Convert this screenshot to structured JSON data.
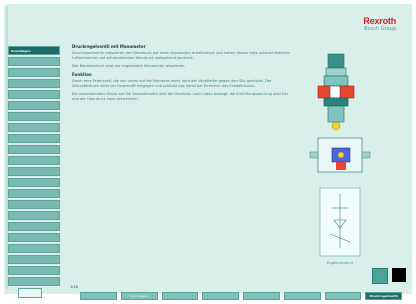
{
  "brand": {
    "name": "Rexroth",
    "sub": "Bosch Group"
  },
  "sidebar": {
    "items": [
      {
        "label": "Grundlagen",
        "active": true
      },
      {
        "label": ""
      },
      {
        "label": ""
      },
      {
        "label": ""
      },
      {
        "label": ""
      },
      {
        "label": ""
      },
      {
        "label": ""
      },
      {
        "label": ""
      },
      {
        "label": ""
      },
      {
        "label": ""
      },
      {
        "label": ""
      },
      {
        "label": ""
      },
      {
        "label": ""
      },
      {
        "label": ""
      },
      {
        "label": ""
      },
      {
        "label": ""
      },
      {
        "label": ""
      },
      {
        "label": ""
      },
      {
        "label": ""
      },
      {
        "label": ""
      },
      {
        "label": ""
      },
      {
        "label": ""
      }
    ]
  },
  "content": {
    "heading": "Druckregelventil mit Manometer",
    "p1": "Druckregelventile reduzieren den Netzdruck auf einen konstanten Arbeitsdruck und halten diesen trotz unterschiedlicher Luftentnahme und schwankendem Netzdruck weitgehend konstant.",
    "p2": "Der Betriebsdruck wird am angebauten Manometer abgelesen.",
    "subheading": "Funktion",
    "p3": "Durch eine Federkraft, die von unten auf die Membran wirkt, wird der Ventilteller gegen den Sitz gedrückt. Der Sekundärdruck wirkt der Federkraft entgegen und schließt das Ventil bei Erreichen des Einstelldrucks.",
    "p4": "Bei zunehmendem Druck auf die Sekundärseite wird die Membran nach unten bewegt, die Entlüftungsbohrung wird frei und der Überdruck kann entweichen."
  },
  "diagrams": {
    "label_a": "A",
    "label_b": "B",
    "caption": "Ergebnismenü"
  },
  "pager": "1/16",
  "tabs": [
    {
      "label": ""
    },
    {
      "label": "Grundlagen",
      "active": false
    },
    {
      "label": ""
    },
    {
      "label": ""
    },
    {
      "label": ""
    },
    {
      "label": ""
    },
    {
      "label": ""
    },
    {
      "label": "Druckregelventil",
      "active": true
    }
  ],
  "colors": {
    "bg": "#d9efe9",
    "nav": "#78b9b1",
    "nav_active": "#1b6b6a",
    "brand": "#d3202e"
  }
}
